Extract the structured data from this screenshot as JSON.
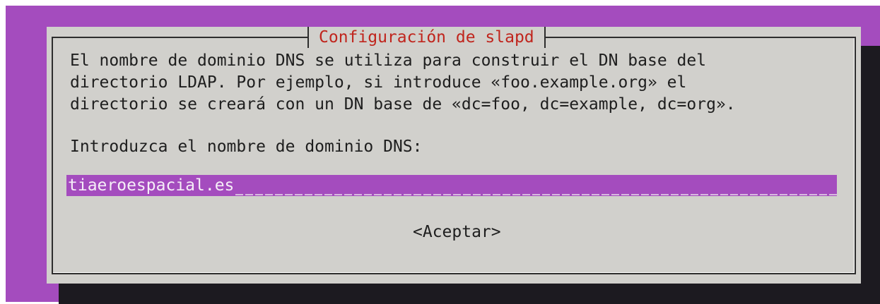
{
  "dialog": {
    "title": "Configuración de slapd",
    "description_lines": [
      "El nombre de dominio DNS se utiliza para construir el DN base del",
      "directorio LDAP. Por ejemplo, si introduce «foo.example.org» el",
      "directorio se creará con un DN base de «dc=foo, dc=example, dc=org»."
    ],
    "prompt": "Introduzca el nombre de dominio DNS:",
    "input_value": "tiaeroespacial.es",
    "ok_button_label": "<Aceptar>"
  },
  "colors": {
    "background": "#a44cbe",
    "dialog": "#d1d0cc",
    "title": "#c0251d",
    "shadow": "#1c1a20"
  }
}
